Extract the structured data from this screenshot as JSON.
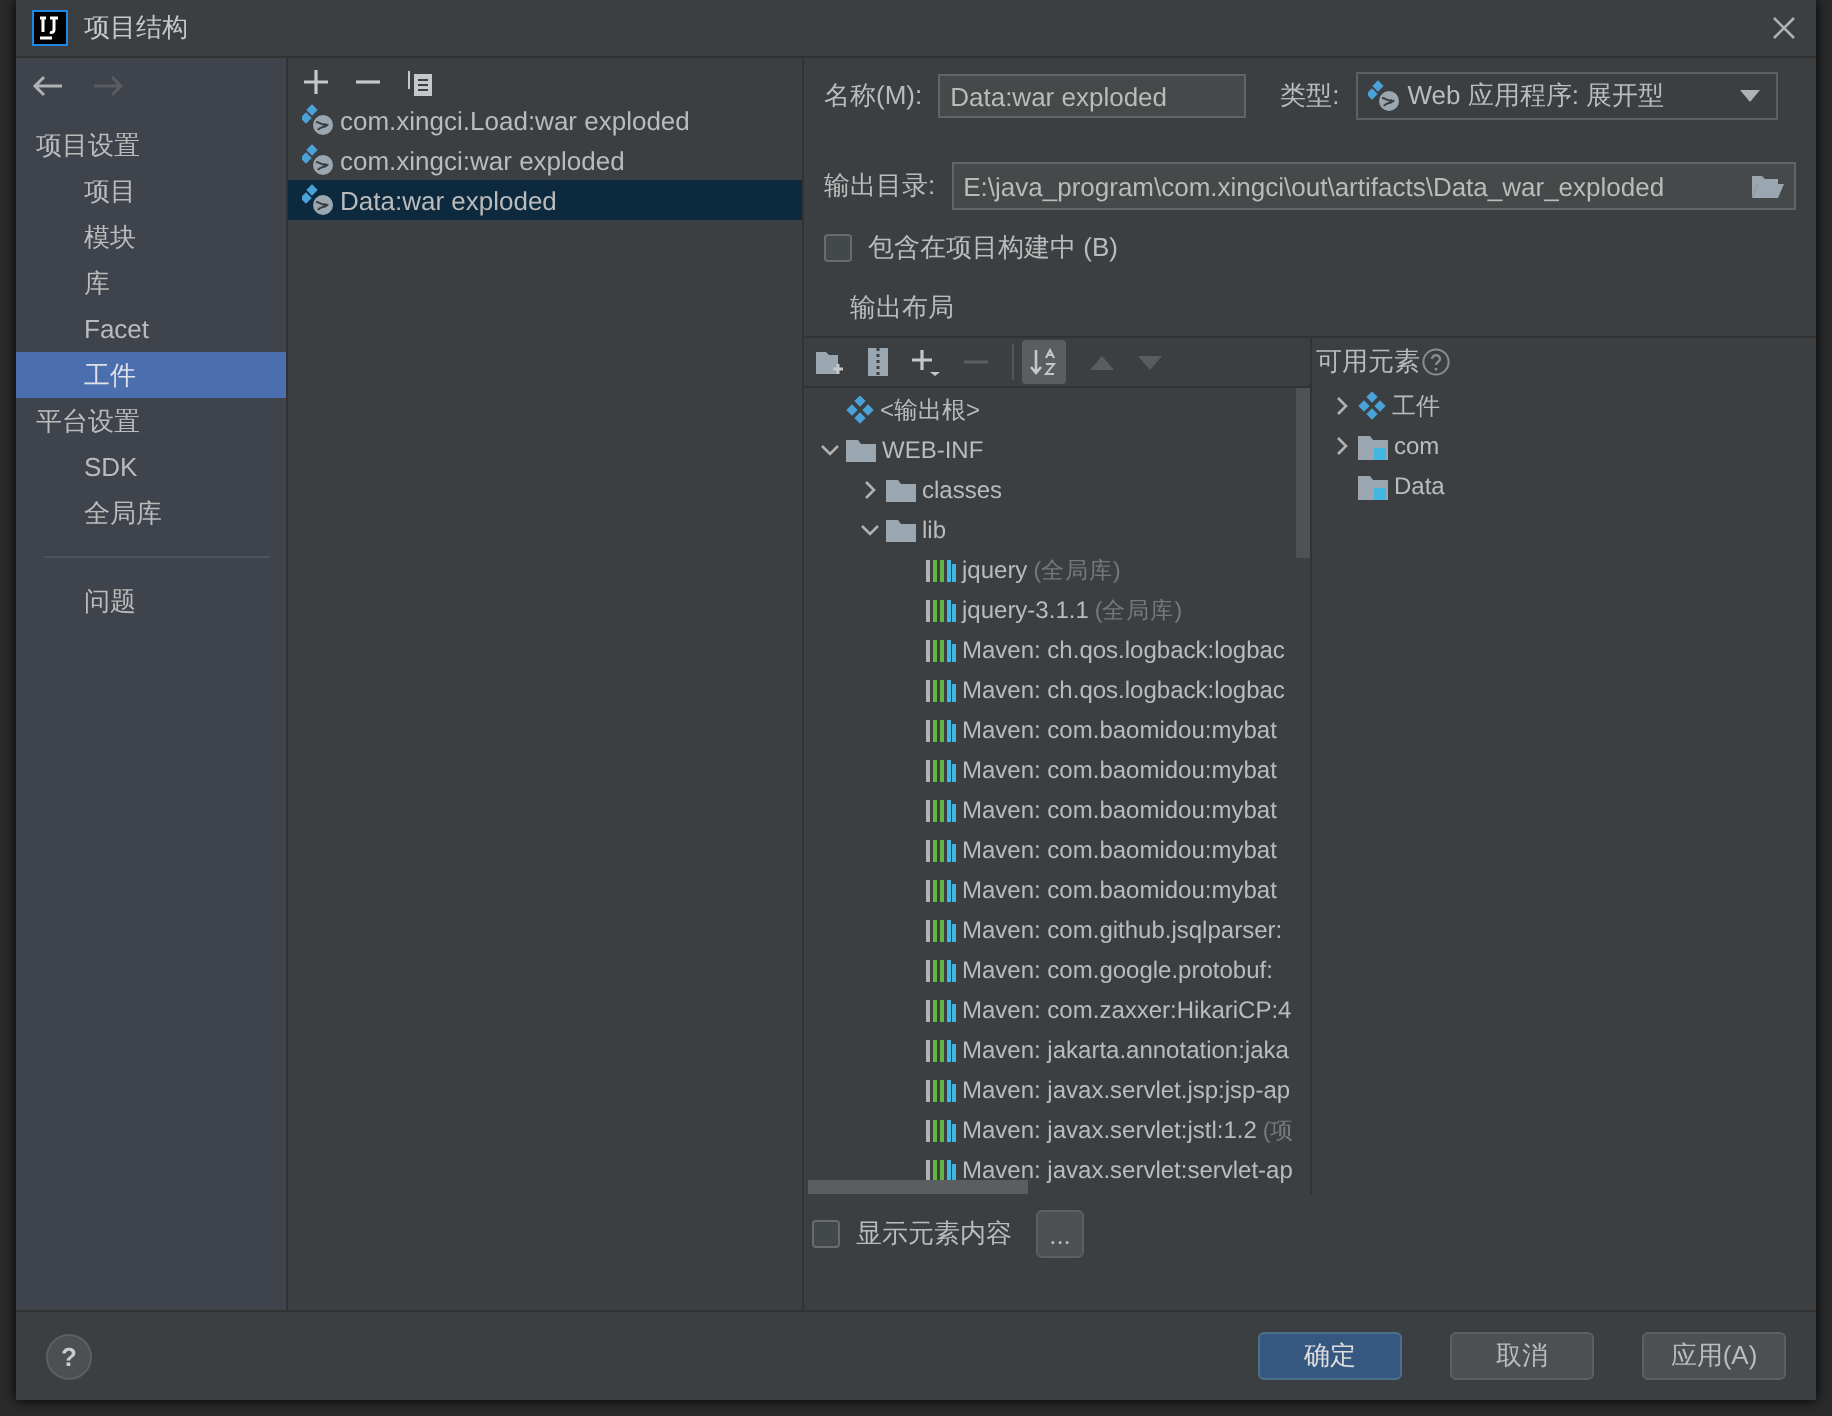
{
  "window": {
    "title": "项目结构"
  },
  "nav": {
    "back_disabled": false,
    "forward_disabled": true
  },
  "sidebar": {
    "sections": [
      {
        "title": "项目设置",
        "items": [
          {
            "label": "项目",
            "selected": false
          },
          {
            "label": "模块",
            "selected": false
          },
          {
            "label": "库",
            "selected": false
          },
          {
            "label": "Facet",
            "selected": false
          },
          {
            "label": "工件",
            "selected": true
          }
        ]
      },
      {
        "title": "平台设置",
        "items": [
          {
            "label": "SDK",
            "selected": false
          },
          {
            "label": "全局库",
            "selected": false
          }
        ]
      }
    ],
    "bottom_items": [
      {
        "label": "问题",
        "selected": false
      }
    ]
  },
  "artifacts": [
    {
      "label": "com.xingci.Load:war exploded",
      "selected": false
    },
    {
      "label": "com.xingci:war exploded",
      "selected": false
    },
    {
      "label": "Data:war exploded",
      "selected": true
    }
  ],
  "form": {
    "name_label": "名称(M):",
    "name_value": "Data:war exploded",
    "type_label": "类型:",
    "type_value": "Web 应用程序: 展开型",
    "output_label": "输出目录:",
    "output_value": "E:\\java_program\\com.xingci\\out\\artifacts\\Data_war_exploded",
    "include_label": "包含在项目构建中 (B)",
    "include_checked": false,
    "layout_tab": "输出布局"
  },
  "layout_tree": [
    {
      "label": "<输出根>",
      "kind": "root"
    },
    {
      "label": "WEB-INF",
      "kind": "folder",
      "expanded": true,
      "children": [
        {
          "label": "classes",
          "kind": "folder",
          "expanded": false
        },
        {
          "label": "lib",
          "kind": "folder",
          "expanded": true,
          "children": [
            {
              "label": "jquery",
              "note": "(全局库)",
              "kind": "library"
            },
            {
              "label": "jquery-3.1.1",
              "note": "(全局库)",
              "kind": "library"
            },
            {
              "label": "Maven: ch.qos.logback:logbac",
              "kind": "library"
            },
            {
              "label": "Maven: ch.qos.logback:logbac",
              "kind": "library"
            },
            {
              "label": "Maven: com.baomidou:mybat",
              "kind": "library"
            },
            {
              "label": "Maven: com.baomidou:mybat",
              "kind": "library"
            },
            {
              "label": "Maven: com.baomidou:mybat",
              "kind": "library"
            },
            {
              "label": "Maven: com.baomidou:mybat",
              "kind": "library"
            },
            {
              "label": "Maven: com.baomidou:mybat",
              "kind": "library"
            },
            {
              "label": "Maven: com.github.jsqlparser:",
              "kind": "library"
            },
            {
              "label": "Maven: com.google.protobuf:",
              "kind": "library"
            },
            {
              "label": "Maven: com.zaxxer:HikariCP:4",
              "kind": "library"
            },
            {
              "label": "Maven: jakarta.annotation:jaka",
              "kind": "library"
            },
            {
              "label": "Maven: javax.servlet.jsp:jsp-ap",
              "kind": "library"
            },
            {
              "label": "Maven: javax.servlet:jstl:1.2",
              "note": "(项",
              "kind": "library"
            },
            {
              "label": "Maven: javax.servlet:servlet-ap",
              "kind": "library"
            }
          ]
        }
      ]
    }
  ],
  "available": {
    "title": "可用元素",
    "items": [
      {
        "label": "工件",
        "kind": "root",
        "expanded": false
      },
      {
        "label": "com",
        "kind": "module",
        "expanded": false
      },
      {
        "label": "Data",
        "kind": "module"
      }
    ]
  },
  "show_content": {
    "label": "显示元素内容",
    "checked": false,
    "more": "..."
  },
  "buttons": [
    {
      "label": "确定",
      "kind": "primary"
    },
    {
      "label": "取消",
      "kind": "normal"
    },
    {
      "label": "应用(A)",
      "kind": "normal"
    }
  ],
  "help": "?"
}
